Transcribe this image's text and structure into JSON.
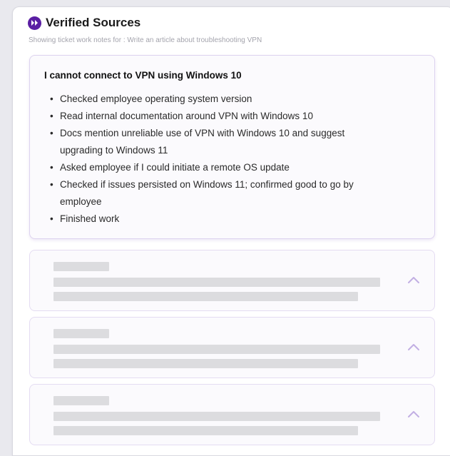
{
  "header": {
    "title": "Verified Sources",
    "subtitle": "Showing ticket work notes for : Write an article about troubleshooting VPN",
    "brand_icon": "double-chevron-right-icon",
    "accent_color": "#5a1ea3"
  },
  "source_card": {
    "title": "I cannot connect to VPN using Windows 10",
    "notes": [
      "Checked employee operating system version",
      "Read internal documentation around VPN with Windows 10",
      "Docs mention unreliable use of VPN with Windows 10 and suggest upgrading to Windows 11",
      "Asked employee if I could initiate a remote OS update",
      "Checked if issues persisted on Windows 11; confirmed good to go by employee",
      "Finished work"
    ]
  },
  "placeholder_cards": [
    {
      "state": "loading",
      "toggle_icon": "chevron-up-icon"
    },
    {
      "state": "loading",
      "toggle_icon": "chevron-up-icon"
    },
    {
      "state": "loading",
      "toggle_icon": "chevron-up-icon"
    }
  ]
}
